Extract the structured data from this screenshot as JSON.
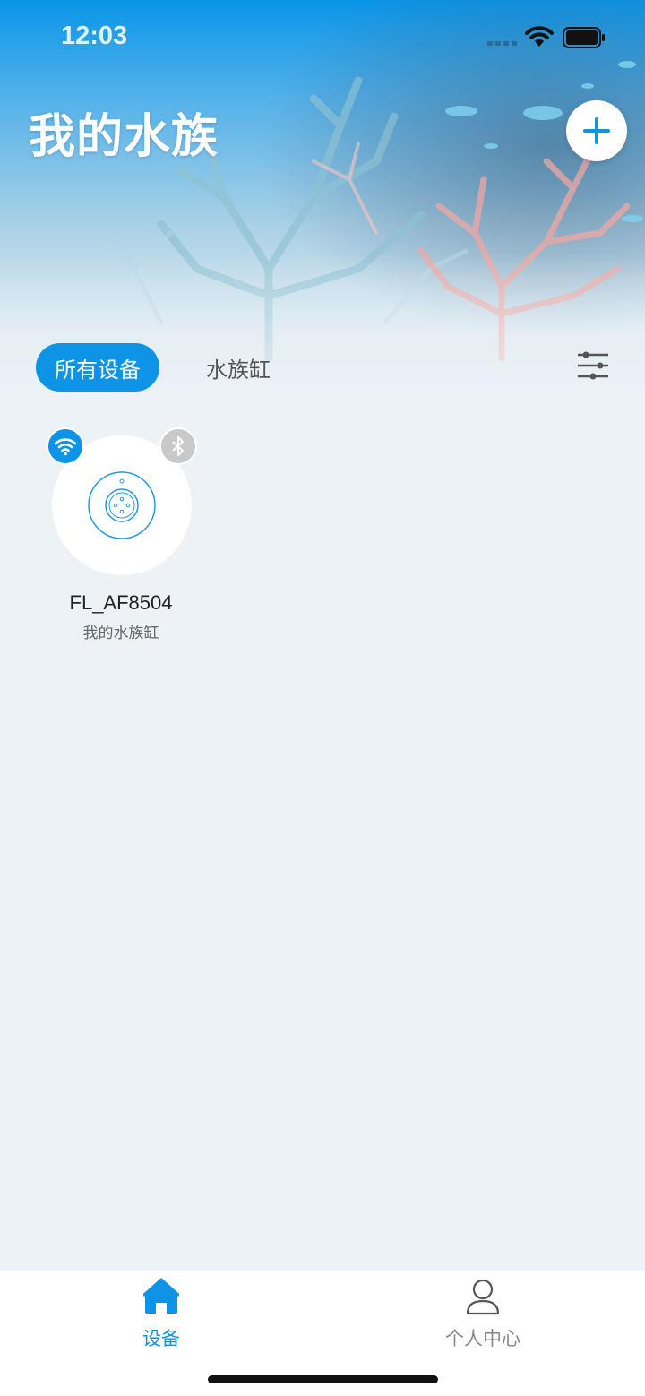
{
  "status_bar": {
    "time": "12:03"
  },
  "header": {
    "title": "我的水族"
  },
  "tabs": [
    {
      "label": "所有设备",
      "active": true
    },
    {
      "label": "水族缸",
      "active": false
    }
  ],
  "devices": [
    {
      "name": "FL_AF8504",
      "subtitle": "我的水族缸",
      "wifi_connected": true,
      "bluetooth_connected": false
    }
  ],
  "bottom_nav": [
    {
      "label": "设备",
      "icon": "home-icon",
      "active": true
    },
    {
      "label": "个人中心",
      "icon": "person-icon",
      "active": false
    }
  ],
  "colors": {
    "accent": "#0e94e6",
    "inactive": "#888888",
    "background": "#ecf2f6"
  }
}
